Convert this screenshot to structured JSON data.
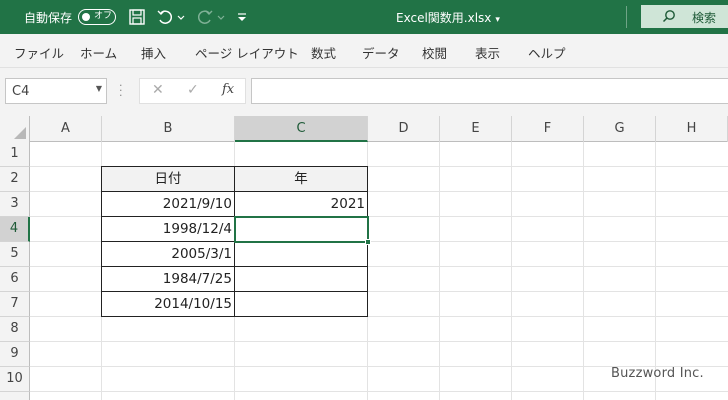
{
  "titlebar": {
    "autosave_label": "自動保存",
    "autosave_state": "オフ",
    "filename": "Excel関数用.xlsx",
    "search_label": "検索",
    "colors": {
      "bar": "#217346",
      "search_bg": "#cfe5d7"
    }
  },
  "ribbon": {
    "tabs": [
      "ファイル",
      "ホーム",
      "挿入",
      "ページ レイアウト",
      "数式",
      "データ",
      "校閲",
      "表示",
      "ヘルプ"
    ]
  },
  "formula_bar": {
    "name_box": "C4",
    "fx_label": "fx",
    "formula": ""
  },
  "sheet": {
    "columns": [
      "A",
      "B",
      "C",
      "D",
      "E",
      "F",
      "G",
      "H"
    ],
    "rows": [
      "1",
      "2",
      "3",
      "4",
      "5",
      "6",
      "7",
      "8",
      "9",
      "10"
    ],
    "selected_cell": "C4",
    "table": {
      "header_b": "日付",
      "header_c": "年",
      "dates": [
        "2021/9/10",
        "1998/12/4",
        "2005/3/1",
        "1984/7/25",
        "2014/10/15"
      ],
      "years": [
        "2021",
        "",
        "",
        "",
        ""
      ]
    }
  },
  "watermark": "Buzzword Inc."
}
